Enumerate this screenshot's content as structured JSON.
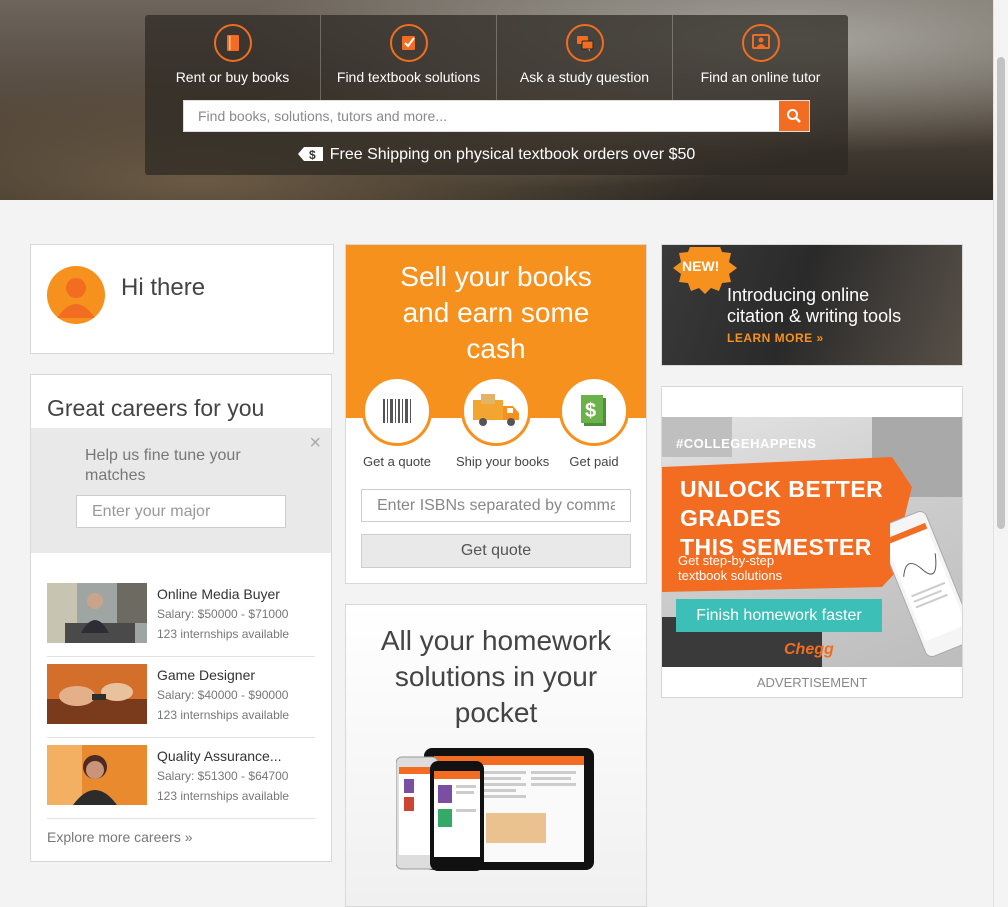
{
  "nav": {
    "categories": [
      {
        "label": "Rent or buy books",
        "icon": "book-icon"
      },
      {
        "label": "Find textbook solutions",
        "icon": "solutions-icon"
      },
      {
        "label": "Ask a study question",
        "icon": "chat-icon"
      },
      {
        "label": "Find an online tutor",
        "icon": "tutor-icon"
      }
    ],
    "search_placeholder": "Find books, solutions, tutors and more...",
    "shipping_text": "Free Shipping on physical textbook orders over $50"
  },
  "greeting": {
    "text": "Hi there"
  },
  "careers": {
    "title": "Great careers for you",
    "tune_message": "Help us fine tune your matches",
    "major_placeholder": "Enter your major",
    "jobs": [
      {
        "title": "Online Media Buyer",
        "salary": "Salary: $50000 - $71000",
        "internships": "123 internships available"
      },
      {
        "title": "Game Designer",
        "salary": "Salary: $40000 - $90000",
        "internships": "123 internships available"
      },
      {
        "title": "Quality Assurance...",
        "salary": "Salary: $51300 - $64700",
        "internships": "123 internships available"
      }
    ],
    "explore": "Explore more careers »"
  },
  "sell": {
    "title": "Sell your books and earn some cash",
    "steps": [
      "Get a quote",
      "Ship your books",
      "Get paid"
    ],
    "isbn_placeholder": "Enter ISBNs separated by comma",
    "button": "Get quote"
  },
  "homework": {
    "title": "All your homework solutions in your pocket"
  },
  "ad_citation": {
    "badge": "NEW!",
    "line1": "Introducing online",
    "line2": "citation & writing tools",
    "link": "LEARN MORE »"
  },
  "ad_grades": {
    "hashtag": "#COLLEGEHAPPENS",
    "headline1": "UNLOCK BETTER GRADES",
    "headline2": "THIS SEMESTER",
    "sub1": "Get step-by-step",
    "sub2": "textbook solutions",
    "cta": "Finish homework faster",
    "logo": "Chegg",
    "label": "ADVERTISEMENT"
  },
  "colors": {
    "accent": "#f26d21",
    "orange": "#f7911e",
    "teal": "#3cbfb6"
  }
}
